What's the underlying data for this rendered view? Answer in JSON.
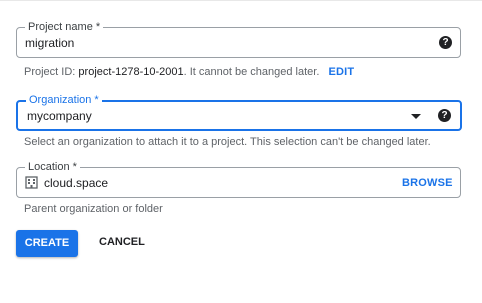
{
  "project_name": {
    "label": "Project name *",
    "value": "migration",
    "help_icon": "help-circle-icon"
  },
  "project_id": {
    "prefix": "Project ID:",
    "id": "project-1278-10-2001",
    "suffix": ". It cannot be changed later.",
    "edit_label": "EDIT"
  },
  "organization": {
    "label": "Organization *",
    "value": "mycompany",
    "dropdown_icon": "caret-down-icon",
    "help_icon": "help-circle-icon",
    "hint": "Select an organization to attach it to a project. This selection can't be changed later."
  },
  "location": {
    "label": "Location *",
    "value": "cloud.space",
    "icon": "building-icon",
    "browse_label": "BROWSE",
    "hint": "Parent organization or folder"
  },
  "actions": {
    "create_label": "CREATE",
    "cancel_label": "CANCEL"
  },
  "colors": {
    "accent": "#1a73e8",
    "border": "#9aa0a6"
  }
}
